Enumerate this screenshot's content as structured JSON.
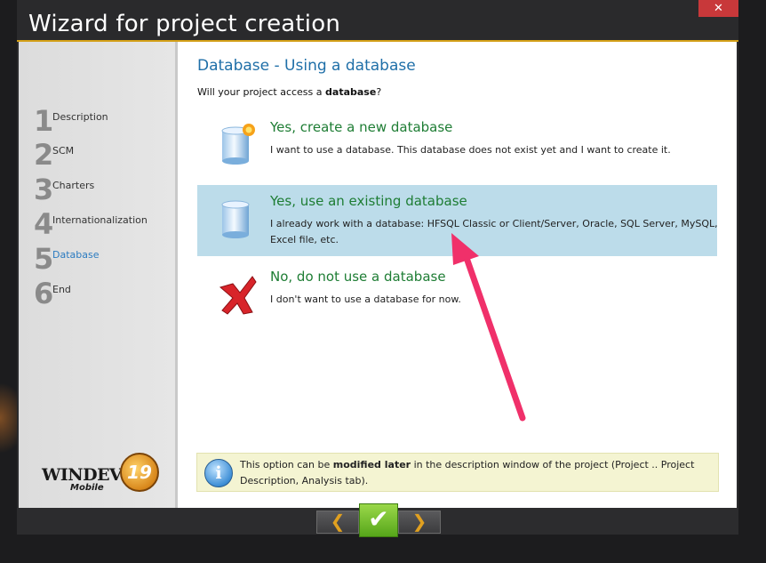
{
  "window": {
    "title": "Wizard for project creation",
    "close_glyph": "✕"
  },
  "steps": [
    {
      "num": "1",
      "label": "Description",
      "active": false
    },
    {
      "num": "2",
      "label": "SCM",
      "active": false
    },
    {
      "num": "3",
      "label": "Charters",
      "active": false
    },
    {
      "num": "4",
      "label": "Internationalization",
      "active": false
    },
    {
      "num": "5",
      "label": "Database",
      "active": true
    },
    {
      "num": "6",
      "label": "End",
      "active": false
    }
  ],
  "logo": {
    "text": "WINDEV",
    "sub": "Mobile",
    "badge": "19"
  },
  "page": {
    "heading": "Database - Using a database",
    "question_prefix": "Will your project access a ",
    "question_bold": "database",
    "question_suffix": "?"
  },
  "options": [
    {
      "title": "Yes, create a new database",
      "desc": "I want to use a database. This database does not exist yet and I want to create it.",
      "icon": "database-new-icon",
      "selected": false
    },
    {
      "title": "Yes, use an existing database",
      "desc": "I already work with a database: HFSQL Classic or Client/Server, Oracle, SQL Server, MySQL, Excel file, etc.",
      "icon": "database-icon",
      "selected": true
    },
    {
      "title": "No, do not use a database",
      "desc": "I don't want to use a database for now.",
      "icon": "red-cross-icon",
      "selected": false
    }
  ],
  "info": {
    "pre": "This option can be ",
    "bold": "modified later",
    "post": " in the description window of the project (Project .. Project Description, Analysis tab)."
  },
  "footer": {
    "prev_glyph": "❮",
    "finish_glyph": "✔",
    "next_glyph": "❯"
  },
  "colors": {
    "accent": "#d4a018",
    "heading": "#1f6fa8",
    "option_title": "#1e7d34",
    "selection": "#bcdcea",
    "annotation_arrow": "#f0306a"
  }
}
